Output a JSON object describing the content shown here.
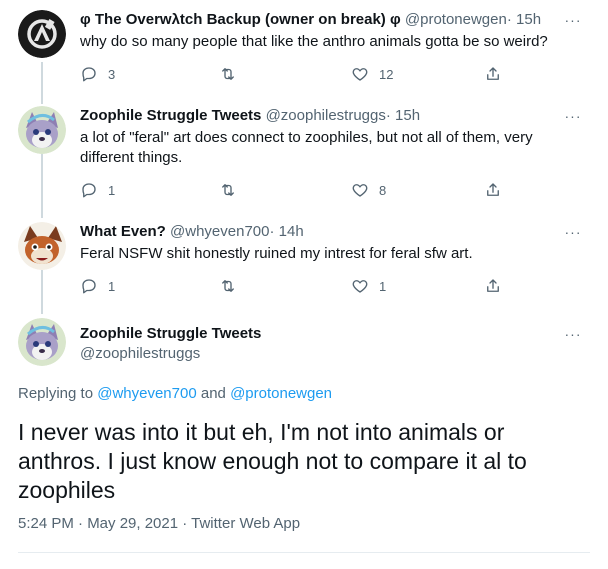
{
  "tweets": [
    {
      "name": "φ The Overwλtch Backup (owner on break) φ",
      "handle": "@protonewgen",
      "dot": "·",
      "time": "15h",
      "text": "why do so many people that like the anthro animals gotta be so weird?",
      "reply_count": "3",
      "retweet_count": "",
      "like_count": "12",
      "avatar_icon": "overwatch-logo-avatar"
    },
    {
      "name": "Zoophile Struggle Tweets",
      "handle": "@zoophilestruggs",
      "dot": "·",
      "time": "15h",
      "text": "a lot of \"feral\" art does connect to zoophiles, but not all of them, very different things.",
      "reply_count": "1",
      "retweet_count": "",
      "like_count": "8",
      "avatar_icon": "cartoon-wolf-avatar"
    },
    {
      "name": "What Even?",
      "handle": "@whyeven700",
      "dot": "·",
      "time": "14h",
      "text": "Feral NSFW shit honestly ruined my intrest for feral sfw art.",
      "reply_count": "1",
      "retweet_count": "",
      "like_count": "1",
      "avatar_icon": "cartoon-fox-avatar"
    }
  ],
  "main_tweet": {
    "name": "Zoophile Struggle Tweets",
    "handle": "@zoophilestruggs",
    "replying_prefix": "Replying to",
    "replying_user1": "@whyeven700",
    "replying_and": "and",
    "replying_user2": "@protonewgen",
    "text": "I never was into it but eh, I'm not into animals or anthros. I just know enough not to compare it al to zoophiles",
    "timestamp": "5:24 PM · May 29, 2021 · Twitter Web App"
  },
  "more_glyph": "···",
  "colors": {
    "accent": "#1d9bf0",
    "muted": "#536471",
    "text": "#0f1419",
    "thread_line": "#cfd9de"
  }
}
